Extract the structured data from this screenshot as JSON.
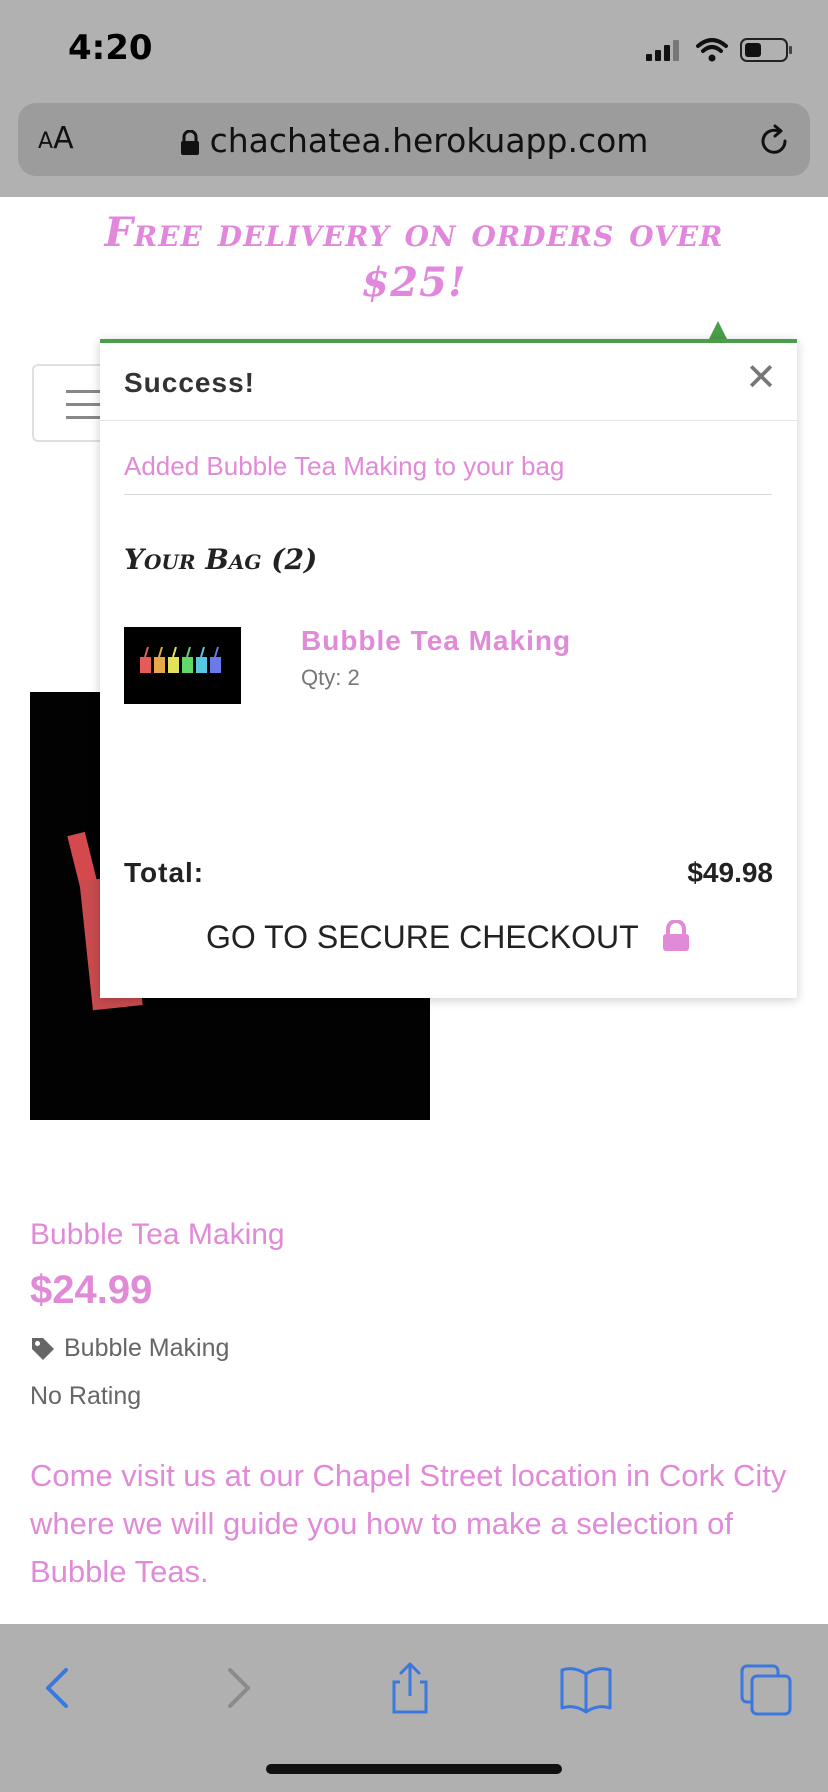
{
  "status_bar": {
    "time": "4:20",
    "icons": [
      "signal-icon",
      "wifi-icon",
      "battery-icon"
    ]
  },
  "browser": {
    "aa_label_small": "A",
    "aa_label_large": "A",
    "url": "chachatea.herokuapp.com"
  },
  "page": {
    "promo_line1": "Free delivery on orders over",
    "promo_line2": "$25!"
  },
  "popup": {
    "title": "Success!",
    "close_label": "✕",
    "message": "Added Bubble Tea Making to your bag",
    "bag_heading": "Your Bag (2)",
    "item": {
      "name": "Bubble Tea Making",
      "qty": "Qty: 2"
    },
    "total_label": "Total:",
    "total_value": "$49.98",
    "checkout_label": "GO TO SECURE CHECKOUT"
  },
  "product": {
    "title": "Bubble Tea Making",
    "price": "$24.99",
    "category": "Bubble Making",
    "rating": "No Rating",
    "description": "Come visit us at our Chapel Street location in Cork City where we will guide you how to make a selection of Bubble Teas."
  },
  "toolbar": {
    "buttons": [
      "back-icon",
      "forward-icon",
      "share-icon",
      "bookmarks-icon",
      "tabs-icon"
    ]
  },
  "colors": {
    "accent_pink": "#e08ad8",
    "success_green": "#4a9e4a",
    "overlay_gray": "#b1b1b1"
  }
}
